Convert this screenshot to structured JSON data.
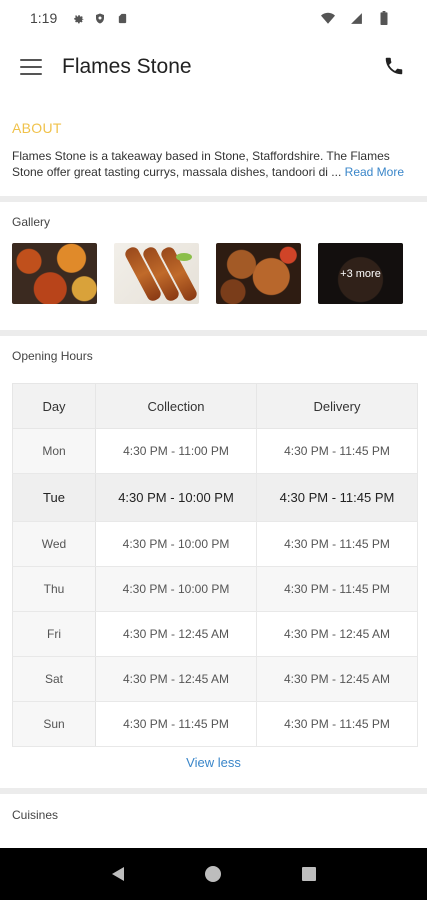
{
  "status_bar": {
    "time": "1:19",
    "icons": [
      "gear-icon",
      "shield-icon",
      "sd-card-icon",
      "wifi-icon",
      "signal-icon",
      "battery-icon"
    ]
  },
  "app_bar": {
    "title": "Flames Stone",
    "menu_icon": "hamburger-icon",
    "call_icon": "phone-icon"
  },
  "about": {
    "heading": "ABOUT",
    "text": "Flames Stone is a takeaway based in Stone, Staffordshire. The Flames Stone offer great tasting currys, massala dishes, tandoori di",
    "ellipsis": "...",
    "read_more": "Read More"
  },
  "gallery": {
    "label": "Gallery",
    "more_label": "+3 more"
  },
  "opening_hours": {
    "label": "Opening Hours",
    "columns": [
      "Day",
      "Collection",
      "Delivery"
    ],
    "rows": [
      {
        "day": "Mon",
        "collection": "4:30 PM - 11:00 PM",
        "delivery": "4:30 PM - 11:45 PM"
      },
      {
        "day": "Tue",
        "collection": "4:30 PM - 10:00 PM",
        "delivery": "4:30 PM - 11:45 PM"
      },
      {
        "day": "Wed",
        "collection": "4:30 PM - 10:00 PM",
        "delivery": "4:30 PM - 11:45 PM"
      },
      {
        "day": "Thu",
        "collection": "4:30 PM - 10:00 PM",
        "delivery": "4:30 PM - 11:45 PM"
      },
      {
        "day": "Fri",
        "collection": "4:30 PM - 12:45 AM",
        "delivery": "4:30 PM - 12:45 AM"
      },
      {
        "day": "Sat",
        "collection": "4:30 PM - 12:45 AM",
        "delivery": "4:30 PM - 12:45 AM"
      },
      {
        "day": "Sun",
        "collection": "4:30 PM - 11:45 PM",
        "delivery": "4:30 PM - 11:45 PM"
      }
    ],
    "view_less": "View less"
  },
  "cuisines": {
    "label": "Cuisines"
  },
  "colors": {
    "accent_heading": "#f0c24b",
    "link": "#3a86c9"
  }
}
